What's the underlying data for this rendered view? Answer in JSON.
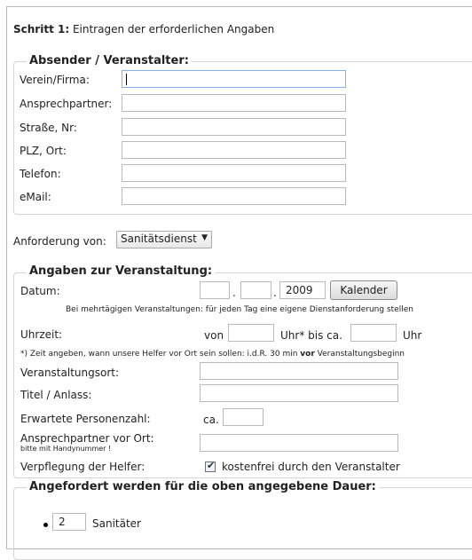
{
  "step": {
    "prefix": "Schritt 1:",
    "text": " Eintragen der erforderlichen Angaben"
  },
  "sender": {
    "legend": "Absender / Veranstalter:",
    "fields": [
      {
        "label": "Verein/Firma:",
        "value": ""
      },
      {
        "label": "Ansprechpartner:",
        "value": ""
      },
      {
        "label": "Straße, Nr:",
        "value": ""
      },
      {
        "label": "PLZ, Ort:",
        "value": ""
      },
      {
        "label": "Telefon:",
        "value": ""
      },
      {
        "label": "eMail:",
        "value": ""
      }
    ]
  },
  "request": {
    "label": "Anforderung von:",
    "selected": "Sanitätsdienst"
  },
  "event": {
    "legend": "Angaben zur Veranstaltung:",
    "date_label": "Datum:",
    "day": "",
    "month": "",
    "year": "2009",
    "calendar_button": "Kalender",
    "multi_day_note": "Bei mehrtägigen Veranstaltungen: für jeden Tag eine eigene Dienstanforderung stellen",
    "time_label": "Uhrzeit:",
    "time_from": "von",
    "time_uhr": "Uhr* bis ca.",
    "time_uhr2": "Uhr",
    "time_note_a": "*) Zeit angeben, wann unsere Helfer vor Ort sein sollen: i.d.R. 30 min ",
    "time_note_bold": "vor",
    "time_note_b": " Veranstaltungsbeginn",
    "place_label": "Veranstaltungsort:",
    "title_label": "Titel / Anlass:",
    "persons_label": "Erwartete Personenzahl:",
    "persons_prefix": "ca.",
    "contact_label": "Ansprechpartner vor Ort:",
    "contact_sub": "bitte mit Handynummer !",
    "catering_label": "Verpflegung der Helfer:",
    "catering_option": "kostenfrei durch den Veranstalter",
    "catering_checked": true
  },
  "requested": {
    "legend": "Angefordert werden für die oben angegebene Dauer:",
    "items": [
      {
        "count": "2",
        "label": "Sanitäter"
      }
    ]
  }
}
